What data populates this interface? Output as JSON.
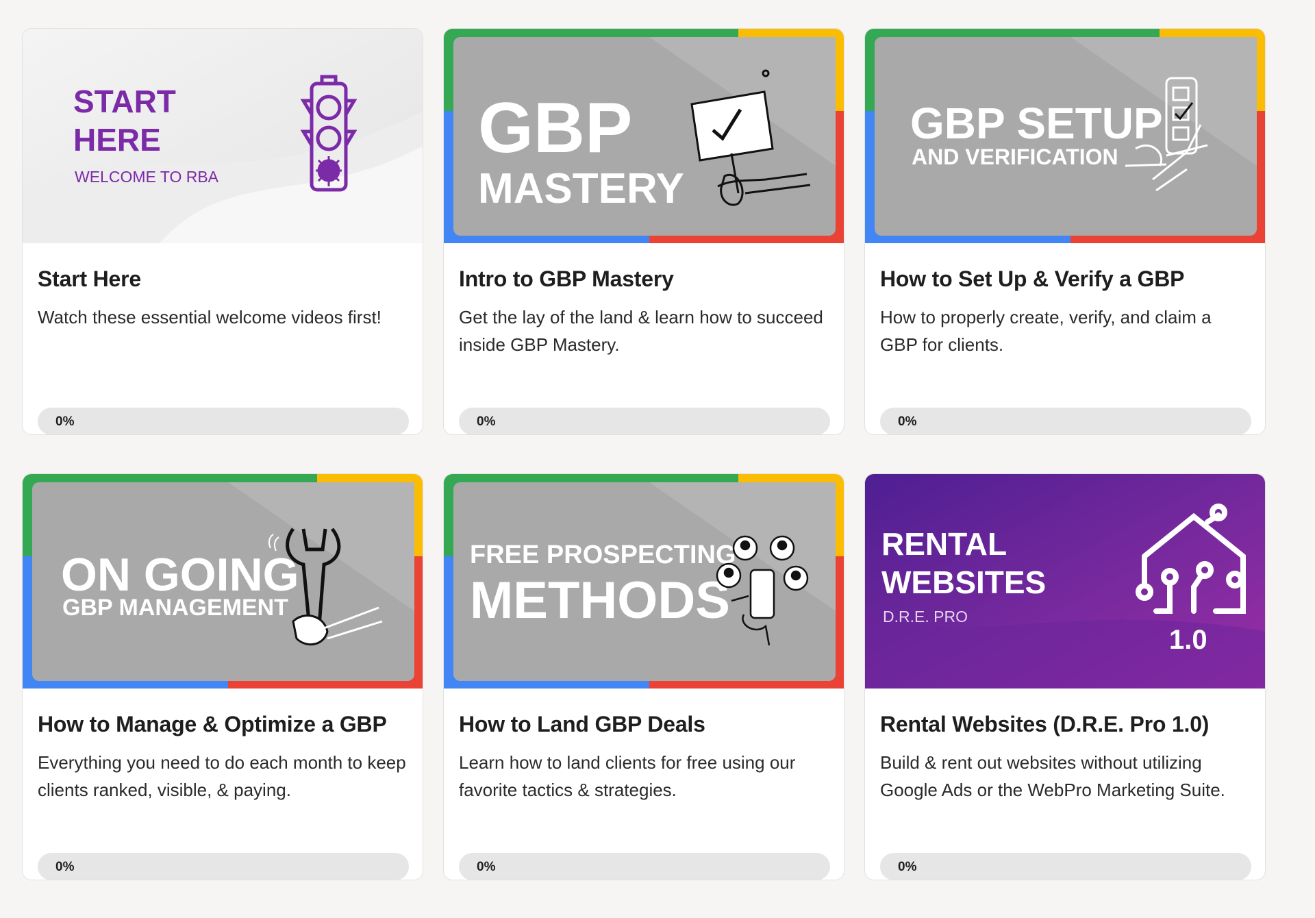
{
  "courses": [
    {
      "title": "Start Here",
      "description": "Watch these essential welcome videos first!",
      "progress_label": "0%",
      "progress": 0,
      "thumbnail": {
        "line1": "START",
        "line2": "HERE",
        "line3": "WELCOME TO RBA",
        "icon": "traffic-light-icon",
        "accent": "#7b2aa8"
      }
    },
    {
      "title": "Intro to GBP Mastery",
      "description": "Get the lay of the land & learn how to succeed inside GBP Mastery.",
      "progress_label": "0%",
      "progress": 0,
      "thumbnail": {
        "line1": "GBP",
        "line2": "MASTERY",
        "icon": "checkmark-sign-icon"
      }
    },
    {
      "title": "How to Set Up & Verify a GBP",
      "description": "How to properly create, verify, and claim a GBP for clients.",
      "progress_label": "0%",
      "progress": 0,
      "thumbnail": {
        "line1": "GBP SETUP",
        "line2": "AND VERIFICATION",
        "icon": "phone-checklist-icon"
      }
    },
    {
      "title": "How to Manage & Optimize a GBP",
      "description": "Everything you need to do each month to keep clients ranked, visible, & paying.",
      "progress_label": "0%",
      "progress": 0,
      "thumbnail": {
        "line1": "ON GOING",
        "line2": "GBP MANAGEMENT",
        "icon": "wrench-icon"
      }
    },
    {
      "title": "How to Land GBP Deals",
      "description": "Learn how to land clients for free using our favorite tactics & strategies.",
      "progress_label": "0%",
      "progress": 0,
      "thumbnail": {
        "line1": "FREE PROSPECTING",
        "line2": "METHODS",
        "icon": "phone-people-icon"
      }
    },
    {
      "title": "Rental Websites (D.R.E. Pro 1.0)",
      "description": "Build & rent out websites without utilizing Google Ads or the WebPro Marketing Suite.",
      "progress_label": "0%",
      "progress": 0,
      "thumbnail": {
        "line1": "RENTAL",
        "line2": "WEBSITES",
        "line3": "D.R.E. PRO",
        "line4": "1.0",
        "icon": "circuit-house-icon"
      }
    }
  ],
  "colors": {
    "google_green": "#34a853",
    "google_yellow": "#fbbc04",
    "google_blue": "#4285f4",
    "google_red": "#ea4335",
    "start_purple": "#7b2aa8",
    "rental_purple": "#6a1fa0"
  }
}
